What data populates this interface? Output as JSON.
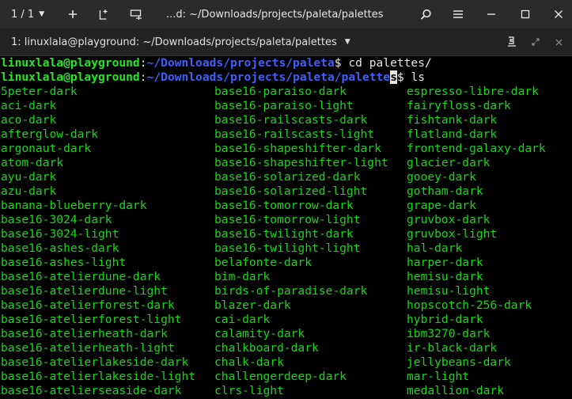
{
  "titlebar": {
    "tab_counter": "1 / 1",
    "title": "...d: ~/Downloads/projects/paleta/palettes"
  },
  "tabbar": {
    "tab_title": "1: linuxlala@playground: ~/Downloads/projects/paleta/palettes"
  },
  "terminal": {
    "prompt_user": "linuxlala@playground",
    "cmd1": {
      "path": "~/Downloads/projects/paleta",
      "command": " cd palettes/"
    },
    "cmd2": {
      "path_main": "~/Downloads/projects/paleta/palette",
      "path_last": "s",
      "command": " ls"
    },
    "rows": [
      [
        "5peter-dark",
        "base16-paraiso-dark",
        "espresso-libre-dark"
      ],
      [
        "aci-dark",
        "base16-paraiso-light",
        "fairyfloss-dark"
      ],
      [
        "aco-dark",
        "base16-railscasts-dark",
        "fishtank-dark"
      ],
      [
        "afterglow-dark",
        "base16-railscasts-light",
        "flatland-dark"
      ],
      [
        "argonaut-dark",
        "base16-shapeshifter-dark",
        "frontend-galaxy-dark"
      ],
      [
        "atom-dark",
        "base16-shapeshifter-light",
        "glacier-dark"
      ],
      [
        "ayu-dark",
        "base16-solarized-dark",
        "gooey-dark"
      ],
      [
        "azu-dark",
        "base16-solarized-light",
        "gotham-dark"
      ],
      [
        "banana-blueberry-dark",
        "base16-tomorrow-dark",
        "grape-dark"
      ],
      [
        "base16-3024-dark",
        "base16-tomorrow-light",
        "gruvbox-dark"
      ],
      [
        "base16-3024-light",
        "base16-twilight-dark",
        "gruvbox-light"
      ],
      [
        "base16-ashes-dark",
        "base16-twilight-light",
        "hal-dark"
      ],
      [
        "base16-ashes-light",
        "belafonte-dark",
        "harper-dark"
      ],
      [
        "base16-atelierdune-dark",
        "bim-dark",
        "hemisu-dark"
      ],
      [
        "base16-atelierdune-light",
        "birds-of-paradise-dark",
        "hemisu-light"
      ],
      [
        "base16-atelierforest-dark",
        "blazer-dark",
        "hopscotch-256-dark"
      ],
      [
        "base16-atelierforest-light",
        "cai-dark",
        "hybrid-dark"
      ],
      [
        "base16-atelierheath-dark",
        "calamity-dark",
        "ibm3270-dark"
      ],
      [
        "base16-atelierheath-light",
        "chalkboard-dark",
        "ir-black-dark"
      ],
      [
        "base16-atelierlakeside-dark",
        "chalk-dark",
        "jellybeans-dark"
      ],
      [
        "base16-atelierlakeside-light",
        "challengerdeep-dark",
        "mar-light"
      ],
      [
        "base16-atelierseaside-dark",
        "clrs-light",
        "medallion-dark"
      ]
    ]
  }
}
